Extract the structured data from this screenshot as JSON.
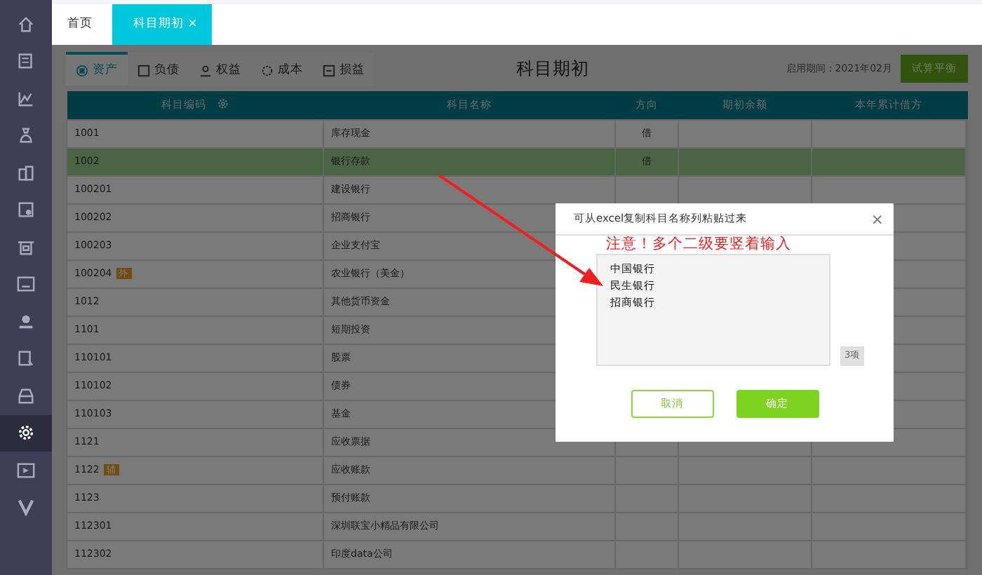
{
  "sidebar": {
    "items": [
      {
        "selected": false
      },
      {
        "selected": false
      },
      {
        "selected": false
      },
      {
        "selected": false
      },
      {
        "selected": false
      },
      {
        "selected": false
      },
      {
        "selected": false
      },
      {
        "selected": false
      },
      {
        "selected": false
      },
      {
        "selected": false
      },
      {
        "selected": false
      },
      {
        "selected": true
      },
      {
        "selected": false
      },
      {
        "selected": false
      }
    ]
  },
  "tabs": [
    {
      "label": "首页",
      "selected": false
    },
    {
      "label": "科目期初",
      "selected": true,
      "close": "×"
    }
  ],
  "sub_tabs": [
    {
      "label": "资产",
      "selected": true
    },
    {
      "label": "负债",
      "selected": false
    },
    {
      "label": "权益",
      "selected": false
    },
    {
      "label": "成本",
      "selected": false
    },
    {
      "label": "损益",
      "selected": false
    }
  ],
  "page_title": "科目期初",
  "period": "启用期间：2021年02月",
  "trial_balance_button": "试算平衡",
  "table": {
    "columns": [
      "科目编码",
      "科目名称",
      "方向",
      "期初余额",
      "本年累计借方"
    ],
    "rows": [
      {
        "code": "1001",
        "name": "库存现金",
        "direction": "借",
        "selected": false
      },
      {
        "code": "1002",
        "name": "银行存款",
        "direction": "借",
        "selected": true
      },
      {
        "code": "100201",
        "name": "建设银行",
        "selected": false
      },
      {
        "code": "100202",
        "name": "招商银行",
        "selected": false
      },
      {
        "code": "100203",
        "name": "企业支付宝",
        "selected": false
      },
      {
        "code": "100204",
        "tag": "外",
        "name": "农业银行（美金）",
        "selected": false
      },
      {
        "code": "1012",
        "name": "其他货币资金",
        "selected": false
      },
      {
        "code": "1101",
        "name": "短期投资",
        "selected": false
      },
      {
        "code": "110101",
        "name": "股票",
        "selected": false
      },
      {
        "code": "110102",
        "name": "债券",
        "selected": false
      },
      {
        "code": "110103",
        "name": "基金",
        "selected": false
      },
      {
        "code": "1121",
        "name": "应收票据",
        "selected": false
      },
      {
        "code": "1122",
        "tag": "辅",
        "name": "应收账款",
        "selected": false
      },
      {
        "code": "1123",
        "name": "预付账款",
        "selected": false
      },
      {
        "code": "112301",
        "name": "深圳联宝小精品有限公司",
        "selected": false
      },
      {
        "code": "112302",
        "name": "印度data公司",
        "selected": false
      }
    ]
  },
  "dialog": {
    "title": "可从excel复制科目名称列粘贴过来",
    "close": "×",
    "lines": [
      "中国银行",
      "民生银行",
      "招商银行"
    ],
    "count": "3项",
    "buttons": [
      {
        "label": "取消",
        "kind": "cancel"
      },
      {
        "label": "确定",
        "kind": "confirm"
      }
    ]
  },
  "annotation": {
    "text": "注意！多个二级要竖着输入"
  }
}
